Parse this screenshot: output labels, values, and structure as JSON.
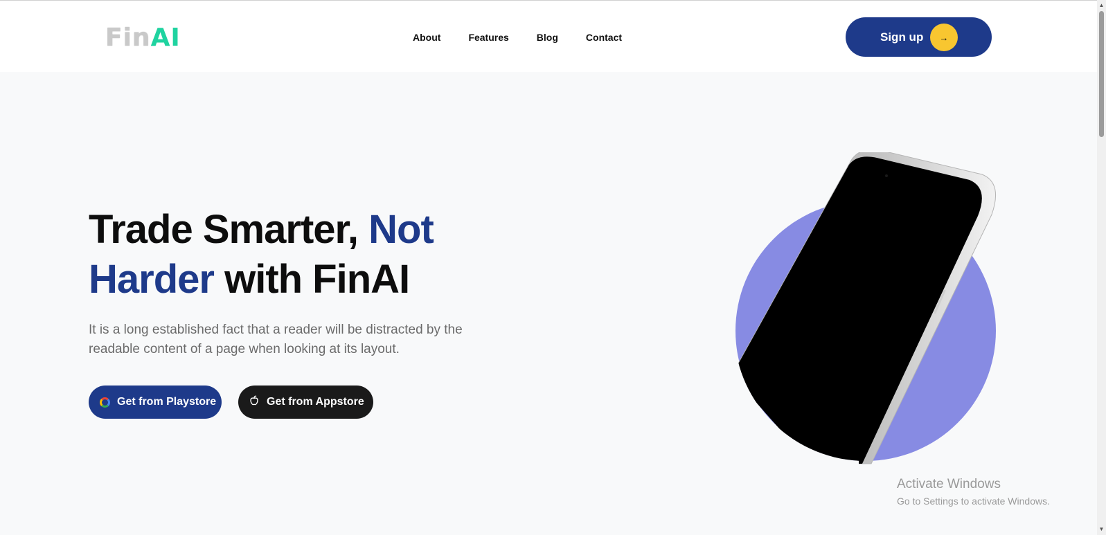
{
  "header": {
    "logo_part1": "Fin",
    "logo_part2": "AI",
    "nav": [
      "About",
      "Features",
      "Blog",
      "Contact"
    ],
    "signup_label": "Sign up",
    "signup_arrow": "→"
  },
  "hero": {
    "title_part1": "Trade Smarter, ",
    "title_accent": "Not Harder",
    "title_part2": " with FinAI",
    "description": "It is a long established fact that a reader will be distracted by the readable content of a page when looking at its layout.",
    "playstore_label": "Get from Playstore",
    "appstore_label": "Get from Appstore"
  },
  "watermark": {
    "title": "Activate Windows",
    "subtitle": "Go to Settings to activate Windows."
  },
  "icons": {
    "playstore": "google-icon",
    "appstore": "apple-icon",
    "signup": "arrow-right-icon"
  },
  "colors": {
    "primary": "#1e3a8a",
    "accent_yellow": "#f8c630",
    "logo_green": "#1fd3a0",
    "circle": "#878be3",
    "dark_button": "#1a1a1a"
  }
}
